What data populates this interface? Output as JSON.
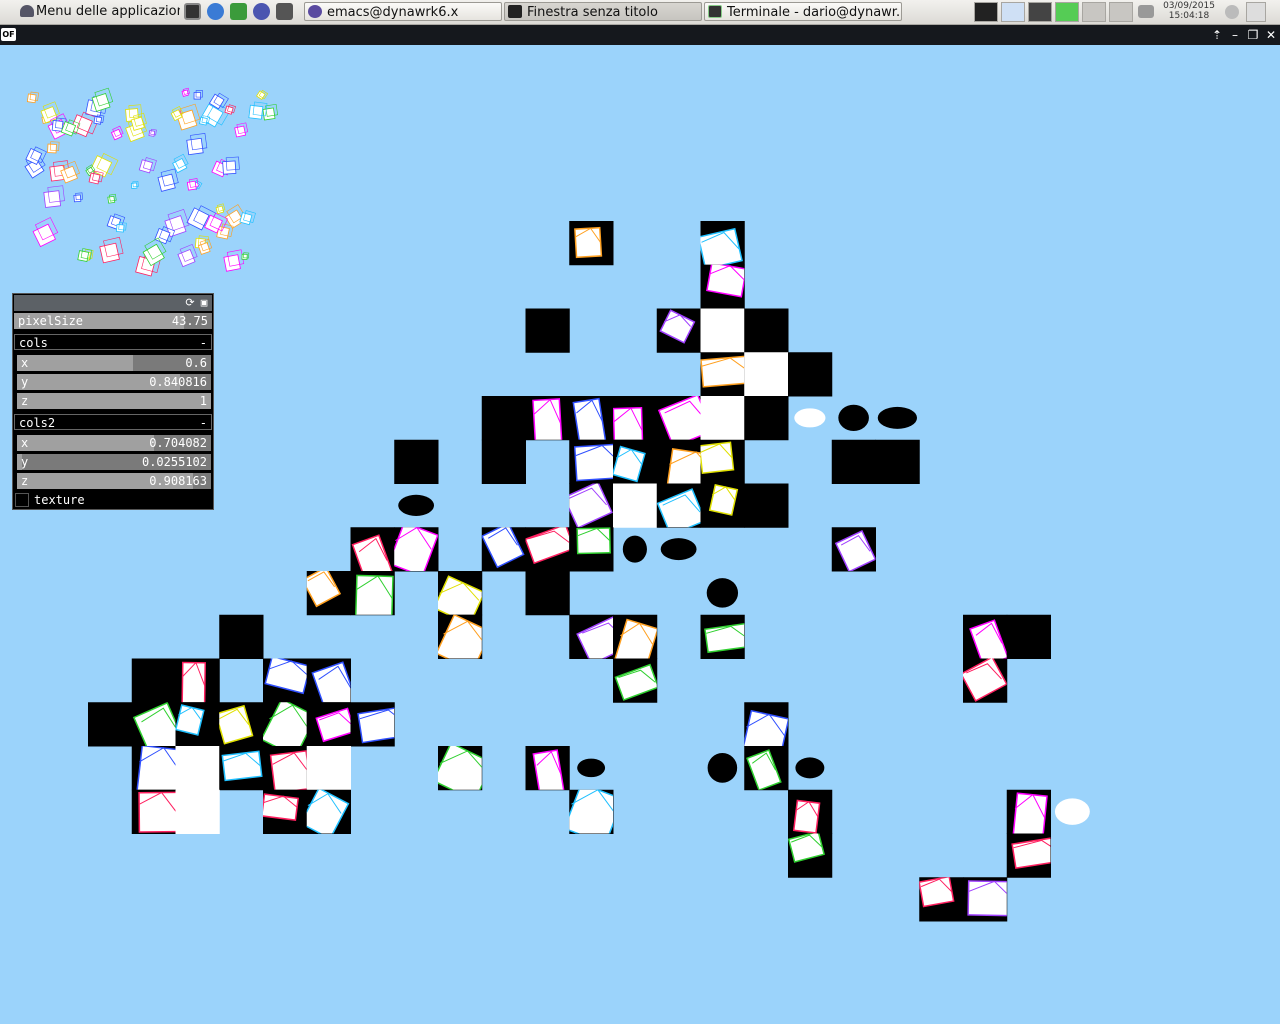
{
  "taskbar": {
    "menu_label": "Menu delle applicazioni",
    "windows": [
      {
        "label": "emacs@dynawrk6.x",
        "icon": "emacs-icon"
      },
      {
        "label": "Finestra senza titolo",
        "icon": "openframeworks-icon"
      },
      {
        "label": "Terminale - dario@dynawr...",
        "icon": "terminal-icon"
      }
    ],
    "quick_launch_icons": [
      "terminal-icon",
      "browser-icon",
      "paint-icon",
      "globe-icon",
      "calculator-icon"
    ],
    "clock_date": "03/09/2015",
    "clock_time": "15:04:18"
  },
  "app_window": {
    "logo_text": "OF",
    "controls": [
      "maximize-up-icon",
      "minimize-icon",
      "restore-icon",
      "close-icon"
    ]
  },
  "gui_panel": {
    "header_icons": [
      "reload-icon",
      "save-icon"
    ],
    "pixelSize": {
      "label": "pixelSize",
      "value": "43.75",
      "fraction": 0.86
    },
    "cols": {
      "label": "cols",
      "toggle": "-",
      "x": {
        "label": "x",
        "value": "0.6",
        "fraction": 0.6
      },
      "y": {
        "label": "y",
        "value": "0.840816",
        "fraction": 0.84
      },
      "z": {
        "label": "z",
        "value": "1",
        "fraction": 1.0
      }
    },
    "cols2": {
      "label": "cols2",
      "toggle": "-",
      "x": {
        "label": "x",
        "value": "0.704082",
        "fraction": 0.704
      },
      "y": {
        "label": "y",
        "value": "0.0255102",
        "fraction": 0.026
      },
      "z": {
        "label": "z",
        "value": "0.908163",
        "fraction": 0.908
      }
    },
    "texture": {
      "label": "texture",
      "checked": false
    }
  },
  "colors": {
    "background": "#9bd3fb",
    "edges": [
      "#ff2060",
      "#ff00ff",
      "#3050ff",
      "#30d030",
      "#ffa020",
      "#e0e000",
      "#20c0ff",
      "#a040ff"
    ]
  }
}
